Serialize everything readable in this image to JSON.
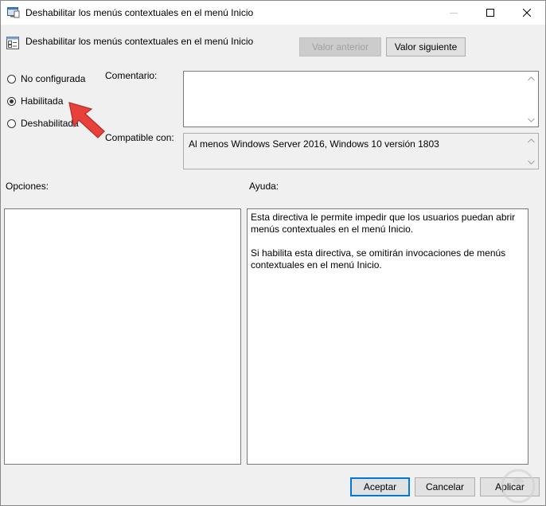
{
  "window": {
    "title": "Deshabilitar los menús contextuales en el menú Inicio",
    "title_icon": "policy-window-icon"
  },
  "header": {
    "policy_name": "Deshabilitar los menús contextuales en el menú Inicio",
    "icon": "policy-setting-icon",
    "prev_button": "Valor anterior",
    "next_button": "Valor siguiente"
  },
  "state": {
    "options": [
      {
        "label": "No configurada",
        "selected": false
      },
      {
        "label": "Habilitada",
        "selected": true
      },
      {
        "label": "Deshabilitada",
        "selected": false
      }
    ]
  },
  "comment": {
    "label": "Comentario:",
    "value": ""
  },
  "supported": {
    "label": "Compatible con:",
    "value": "Al menos Windows Server 2016, Windows 10 versión 1803"
  },
  "options_panel": {
    "label": "Opciones:"
  },
  "help_panel": {
    "label": "Ayuda:",
    "paragraphs": [
      "Esta directiva le permite impedir que los usuarios puedan abrir menús contextuales en el menú Inicio.",
      "Si habilita esta directiva, se omitirán invocaciones de menús contextuales en el menú Inicio."
    ]
  },
  "footer": {
    "ok": "Aceptar",
    "cancel": "Cancelar",
    "apply": "Aplicar"
  },
  "colors": {
    "annotation_arrow": "#e8413b",
    "default_button_border": "#0078d7"
  }
}
